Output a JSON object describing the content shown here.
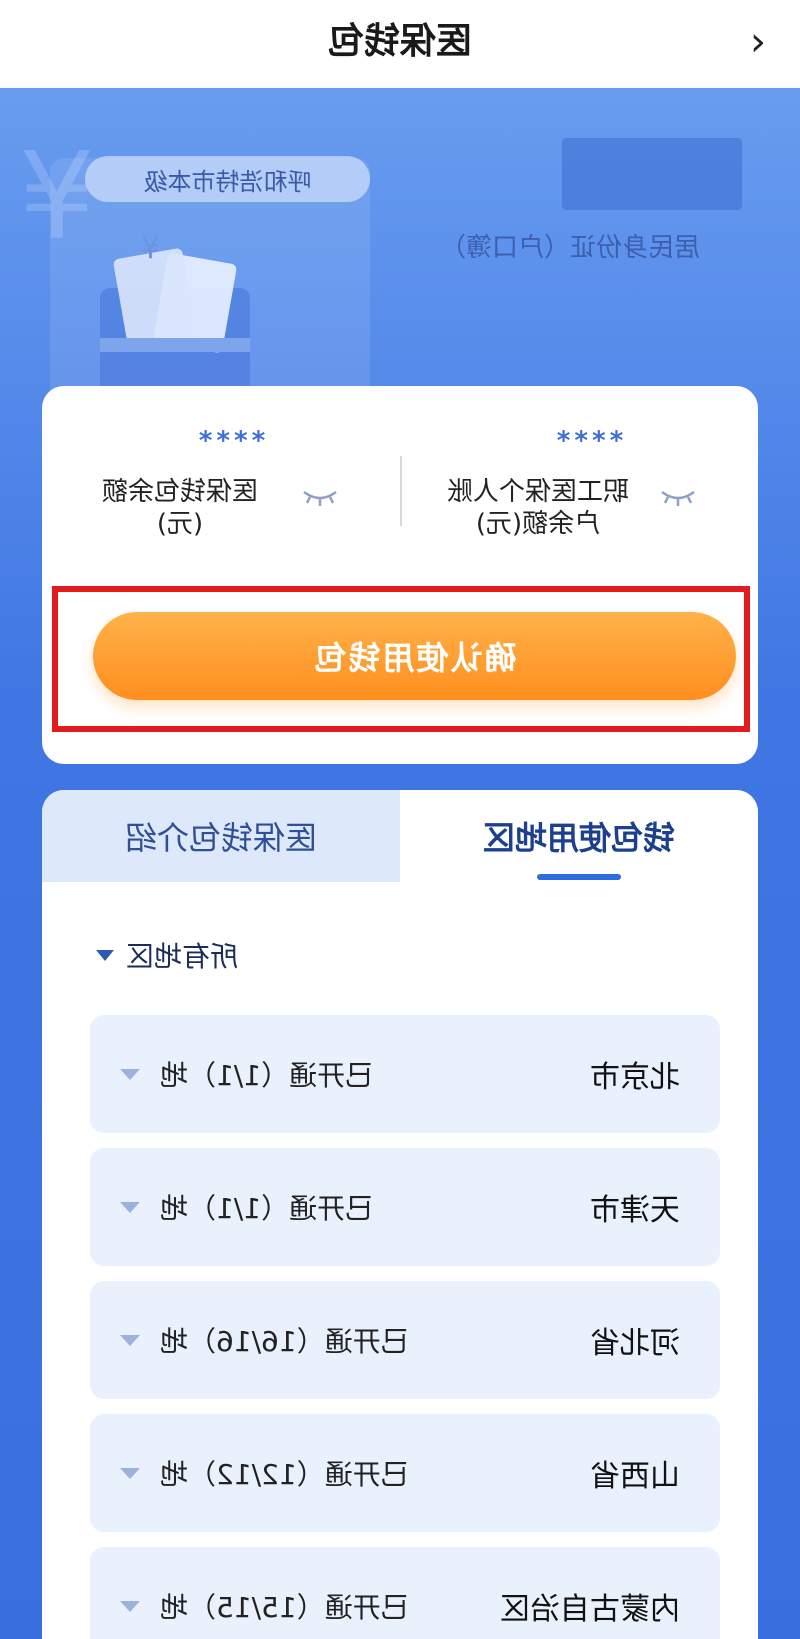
{
  "nav": {
    "title": "医保钱包"
  },
  "hero": {
    "region": "呼和浩特市本级",
    "id_type": "居民身份证（户口簿）"
  },
  "balance": {
    "left": {
      "masked": "****",
      "label": "职工医保个人账户余额(元)"
    },
    "right": {
      "masked": "****",
      "label": "医保钱包余额(元)"
    },
    "confirm_label": "确认使用钱包"
  },
  "tabs": [
    {
      "label": "钱包使用地区",
      "active": true
    },
    {
      "label": "医保钱包介绍",
      "active": false
    }
  ],
  "filter": {
    "label": "所有地区"
  },
  "regions": [
    {
      "name": "北京市",
      "status": "已开通（1/1）地"
    },
    {
      "name": "天津市",
      "status": "已开通（1/1）地"
    },
    {
      "name": "河北省",
      "status": "已开通（16/16）地"
    },
    {
      "name": "山西省",
      "status": "已开通（12/12）地"
    },
    {
      "name": "内蒙古自治区",
      "status": "已开通（15/15）地"
    }
  ],
  "colors": {
    "accent_blue": "#3d72e0",
    "confirm_orange": "#ff9a2a",
    "highlight_red": "#e21c1c"
  }
}
